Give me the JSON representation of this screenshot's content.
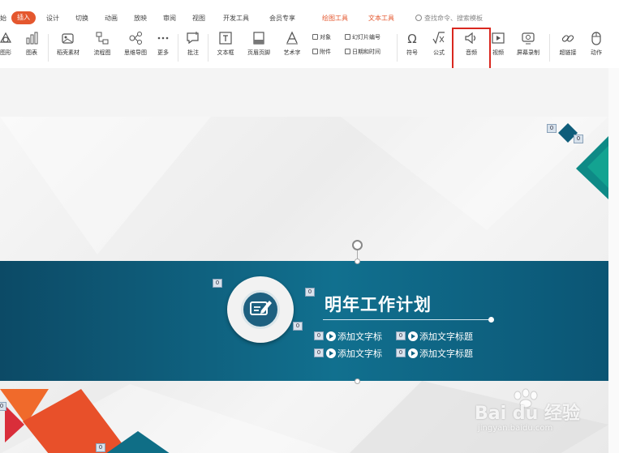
{
  "tabs": {
    "start": "始",
    "insert": "插入",
    "design": "设计",
    "transition": "切换",
    "animation": "动画",
    "slideshow": "放映",
    "review": "审阅",
    "view": "视图",
    "developer": "开发工具",
    "member": "会员专享",
    "drawing_tools": "绘图工具",
    "text_tools": "文本工具"
  },
  "search": {
    "placeholder": "查找命令、搜索模板"
  },
  "ribbon": {
    "shape": "图形",
    "chart": "图表",
    "materials": "稻壳素材",
    "flowchart": "流程图",
    "mindmap": "思维导图",
    "more": "更多",
    "comment": "批注",
    "textbox": "文本框",
    "header_footer": "页眉页脚",
    "wordart": "艺术字",
    "object": "对象",
    "slide_number": "幻灯片编号",
    "attachment": "附件",
    "datetime": "日期和时间",
    "symbol": "符号",
    "formula": "公式",
    "audio": "音频",
    "video": "视频",
    "screen_record": "屏幕录制",
    "hyperlink": "超链接",
    "action": "动作"
  },
  "slide": {
    "title": "明年工作计划",
    "items": [
      "添加文字标",
      "添加文字标题",
      "添加文字标",
      "添加文字标题"
    ],
    "placeholder_badge": "0"
  },
  "watermark": {
    "brand": "Bai du 经验",
    "url": "jingyan.baidu.com"
  },
  "colors": {
    "accent": "#e4572e",
    "highlight": "#d9281f",
    "banner": "#0f6483"
  }
}
